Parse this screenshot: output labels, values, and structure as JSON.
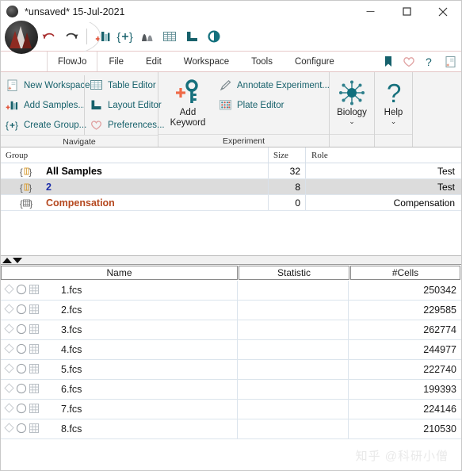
{
  "window": {
    "title": "*unsaved* 15-Jul-2021",
    "logo_icon": "flowjo-orb-icon",
    "controls": {
      "minimize": "minimize-icon",
      "maximize": "maximize-icon",
      "close": "close-icon"
    }
  },
  "quick_access": {
    "items": [
      {
        "name": "undo-icon",
        "tooltip": "Undo"
      },
      {
        "name": "redo-icon",
        "tooltip": "Redo"
      },
      {
        "name": "add-samples-icon",
        "tooltip": "Add Samples"
      },
      {
        "name": "create-group-icon",
        "tooltip": "Create Group"
      },
      {
        "name": "histogram-icon",
        "tooltip": "Histogram"
      },
      {
        "name": "table-editor-icon",
        "tooltip": "Table Editor"
      },
      {
        "name": "layout-editor-icon",
        "tooltip": "Layout Editor"
      },
      {
        "name": "biology-icon",
        "tooltip": "Biology"
      }
    ]
  },
  "menubar": {
    "items": [
      {
        "label": "FlowJo"
      },
      {
        "label": "File"
      },
      {
        "label": "Edit"
      },
      {
        "label": "Workspace"
      },
      {
        "label": "Tools"
      },
      {
        "label": "Configure"
      }
    ],
    "right_icons": [
      {
        "name": "bookmark-icon"
      },
      {
        "name": "heart-icon"
      },
      {
        "name": "question-mark-icon"
      },
      {
        "name": "new-workspace-icon"
      }
    ]
  },
  "ribbon": {
    "groups": [
      {
        "caption": "Navigate",
        "items": [
          {
            "label": "New Workspace",
            "icon": "new-workspace-icon"
          },
          {
            "label": "Add Samples...",
            "icon": "add-samples-icon"
          },
          {
            "label": "Create Group...",
            "icon": "create-group-icon"
          },
          {
            "label": "Table Editor",
            "icon": "table-editor-icon"
          },
          {
            "label": "Layout Editor",
            "icon": "layout-editor-icon"
          },
          {
            "label": "Preferences...",
            "icon": "heart-icon"
          }
        ]
      },
      {
        "caption": "Experiment",
        "big_button": {
          "line1": "Add",
          "line2": "Keyword",
          "icon": "add-keyword-icon"
        },
        "items": [
          {
            "label": "Annotate Experiment...",
            "icon": "pencil-icon"
          },
          {
            "label": "Plate Editor",
            "icon": "plate-editor-icon"
          }
        ]
      },
      {
        "caption": "",
        "big_button": {
          "line1": "Biology",
          "line2": "",
          "icon": "biology-icon",
          "chevron": "⌄"
        }
      },
      {
        "caption": "",
        "big_button": {
          "line1": "Help",
          "line2": "",
          "icon": "question-mark-icon",
          "chevron": "⌄"
        }
      }
    ]
  },
  "group_panel": {
    "columns": [
      "Group",
      "Size",
      "Role"
    ],
    "rows": [
      {
        "icon": "group-brace-icon",
        "name": "All Samples",
        "size": "32",
        "role": "Test",
        "color": "#000000",
        "selected": false
      },
      {
        "icon": "group-brace-icon",
        "name": "2",
        "size": "8",
        "role": "Test",
        "color": "#1d2ea8",
        "selected": true
      },
      {
        "icon": "comp-matrix-icon",
        "name": "Compensation",
        "size": "0",
        "role": "Compensation",
        "color": "#b5481f",
        "selected": false
      }
    ]
  },
  "splitter": {
    "up_icon": "triangle-up-icon",
    "down_icon": "triangle-down-icon"
  },
  "sample_panel": {
    "columns": [
      "Name",
      "Statistic",
      "#Cells"
    ],
    "row_icons": [
      "diamond-icon",
      "circle-icon",
      "grid-icon"
    ],
    "rows": [
      {
        "name": "1.fcs",
        "statistic": "",
        "cells": "250342"
      },
      {
        "name": "2.fcs",
        "statistic": "",
        "cells": "229585"
      },
      {
        "name": "3.fcs",
        "statistic": "",
        "cells": "262774"
      },
      {
        "name": "4.fcs",
        "statistic": "",
        "cells": "244977"
      },
      {
        "name": "5.fcs",
        "statistic": "",
        "cells": "222740"
      },
      {
        "name": "6.fcs",
        "statistic": "",
        "cells": "199393"
      },
      {
        "name": "7.fcs",
        "statistic": "",
        "cells": "224146"
      },
      {
        "name": "8.fcs",
        "statistic": "",
        "cells": "210530"
      }
    ]
  },
  "watermark": {
    "text": "知乎 @科研小僧"
  },
  "colors": {
    "accent_teal": "#17616b",
    "selection_gray": "#dcdcdc",
    "compensation_orange": "#b5481f",
    "group_blue": "#1d2ea8"
  }
}
